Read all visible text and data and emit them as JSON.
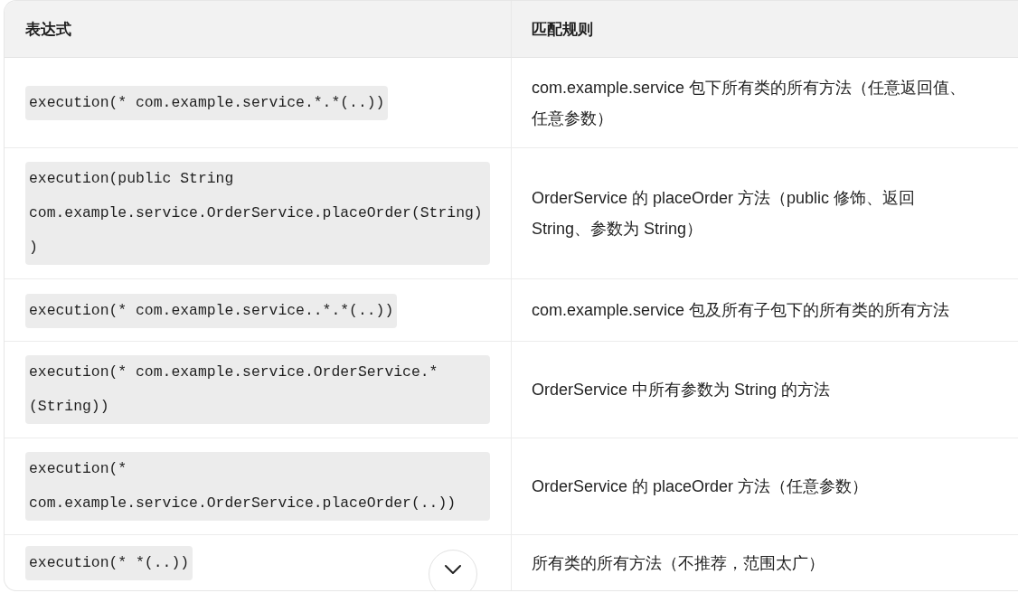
{
  "table": {
    "columns": [
      "表达式",
      "匹配规则"
    ],
    "rows": [
      {
        "expression": "execution(* com.example.service.*.*(..))",
        "matches": "com.example.service 包下所有类的所有方法（任意返回值、任意参数）"
      },
      {
        "expression": "execution(public String com.example.service.OrderService.placeOrder(String))",
        "matches": "OrderService 的 placeOrder 方法（public 修饰、返回 String、参数为 String）"
      },
      {
        "expression": "execution(* com.example.service..*.*(..))",
        "matches": "com.example.service 包及所有子包下的所有类的所有方法"
      },
      {
        "expression": "execution(* com.example.service.OrderService.*(String))",
        "matches": "OrderService 中所有参数为 String 的方法"
      },
      {
        "expression": "execution(* com.example.service.OrderService.placeOrder(..))",
        "matches": "OrderService 的 placeOrder 方法（任意参数）"
      },
      {
        "expression": "execution(* *(..))",
        "matches": "所有类的所有方法（不推荐，范围太广）"
      }
    ]
  }
}
